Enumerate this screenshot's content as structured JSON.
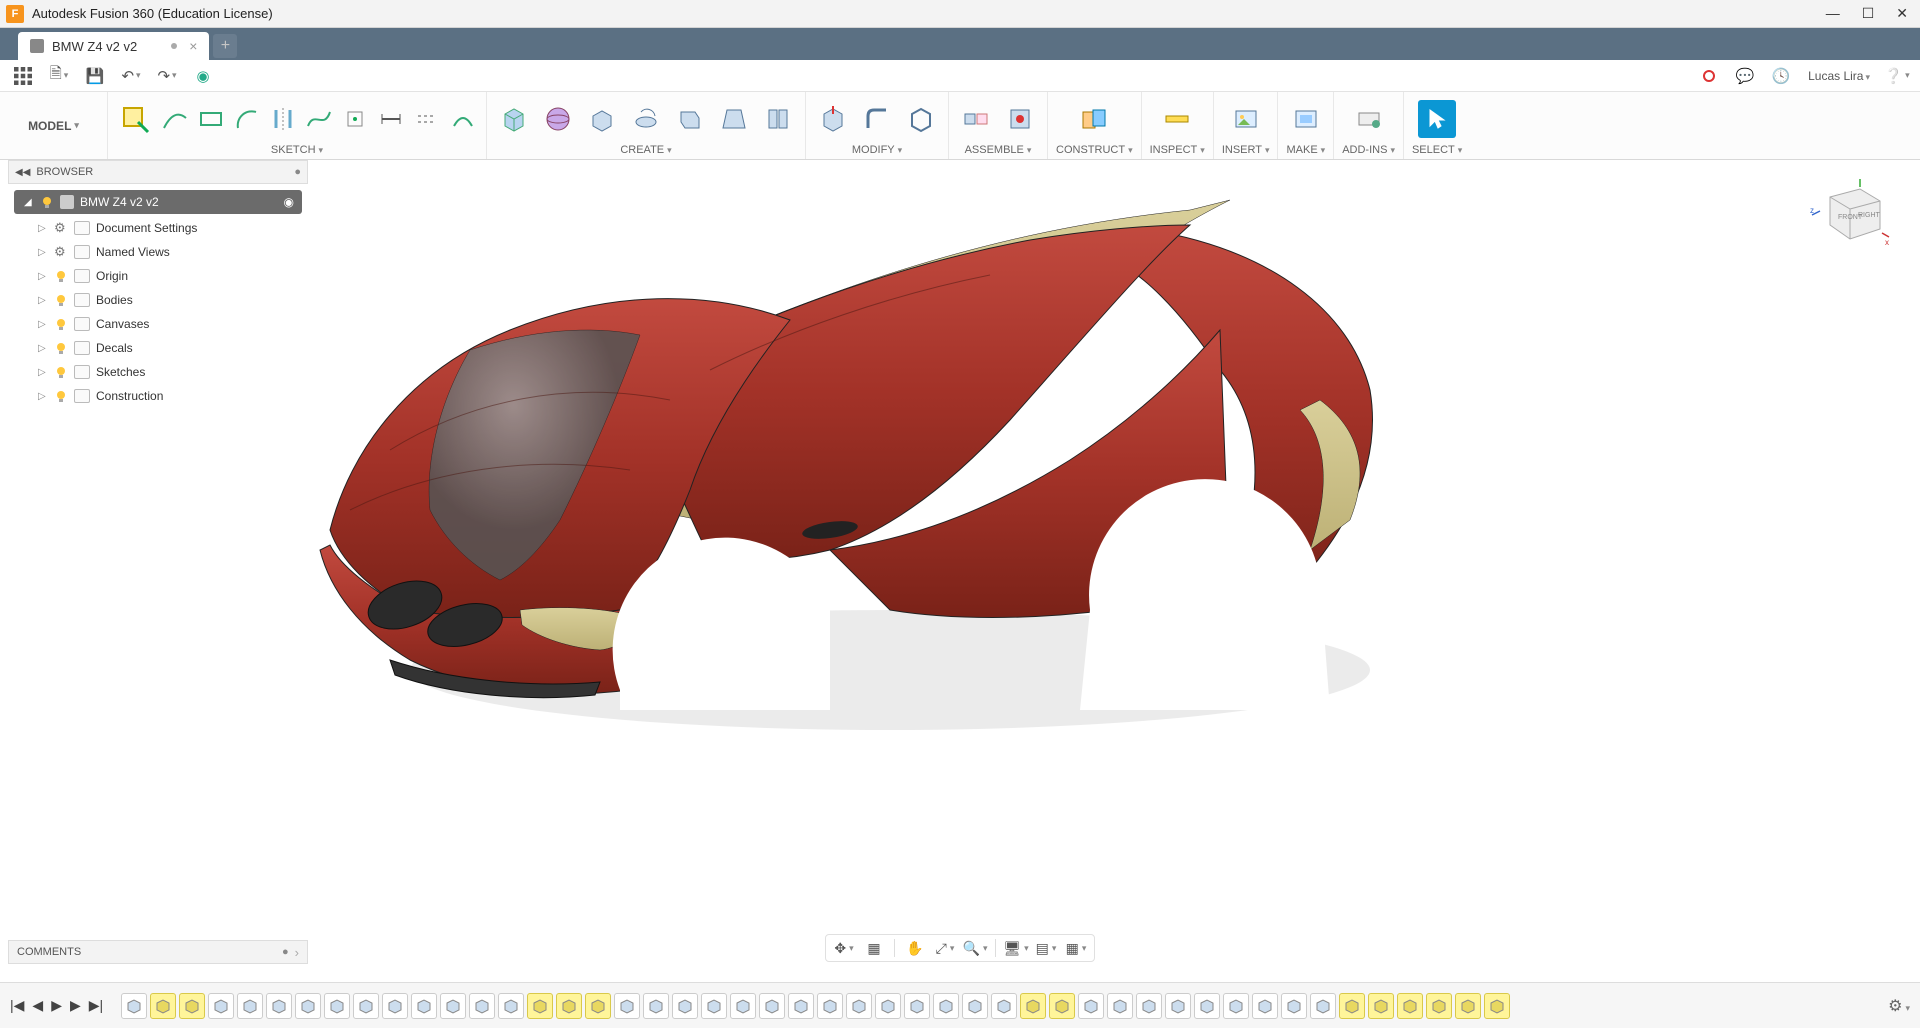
{
  "window": {
    "title": "Autodesk Fusion 360 (Education License)"
  },
  "tab": {
    "name": "BMW Z4 v2 v2"
  },
  "qat": {
    "user": "Lucas Lira"
  },
  "ribbon": {
    "workspace": "MODEL",
    "groups": {
      "sketch": "SKETCH",
      "create": "CREATE",
      "modify": "MODIFY",
      "assemble": "ASSEMBLE",
      "construct": "CONSTRUCT",
      "inspect": "INSPECT",
      "insert": "INSERT",
      "make": "MAKE",
      "addins": "ADD-INS",
      "select": "SELECT"
    }
  },
  "browser": {
    "header": "BROWSER",
    "root": "BMW Z4 v2 v2",
    "items": [
      {
        "label": "Document Settings",
        "icon": "gear"
      },
      {
        "label": "Named Views",
        "icon": "folder"
      },
      {
        "label": "Origin",
        "icon": "folder",
        "bulb": true
      },
      {
        "label": "Bodies",
        "icon": "folder",
        "bulb": true
      },
      {
        "label": "Canvases",
        "icon": "folder",
        "bulb": true
      },
      {
        "label": "Decals",
        "icon": "folder",
        "bulb": true
      },
      {
        "label": "Sketches",
        "icon": "folder",
        "bulb": true
      },
      {
        "label": "Construction",
        "icon": "folder",
        "bulb": true
      }
    ]
  },
  "comments": {
    "label": "COMMENTS"
  },
  "viewcube": {
    "front": "FRONT",
    "right": "RIGHT"
  },
  "timeline": {
    "ops_count": 48,
    "highlighted": [
      1,
      2,
      14,
      15,
      16,
      31,
      32,
      42,
      43,
      44,
      45,
      46,
      47
    ]
  }
}
